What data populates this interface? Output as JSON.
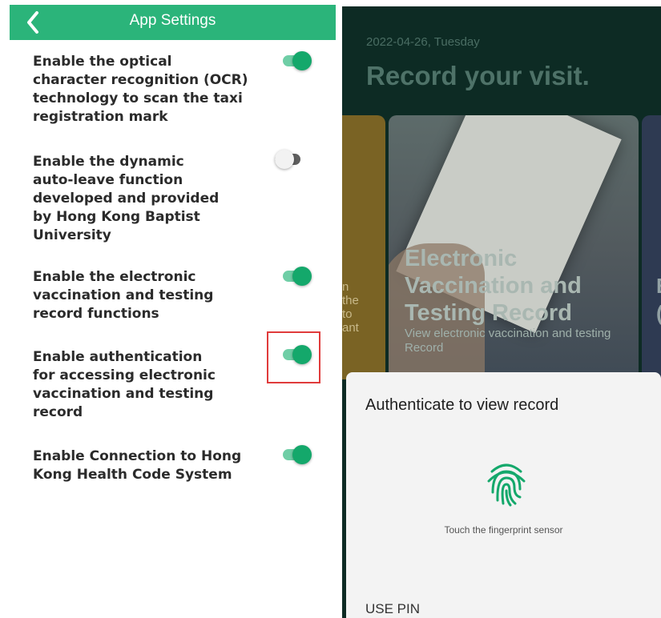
{
  "left_panel": {
    "title": "App Settings",
    "settings": [
      {
        "label": "Enable the optical character recognition (OCR) technology to scan the taxi registration mark",
        "enabled": true
      },
      {
        "label": "Enable the dynamic auto-leave function developed and provided by Hong Kong Baptist University",
        "enabled": false
      },
      {
        "label": "Enable the electronic vaccination and testing record functions",
        "enabled": true
      },
      {
        "label": "Enable authentication for accessing electronic vaccination and testing record",
        "enabled": true
      },
      {
        "label": "Enable Connection to Hong Kong Health Code System",
        "enabled": true
      }
    ],
    "colors": {
      "accent": "#2bb47a",
      "toggle_on": "#14a86b",
      "highlight": "#e03b3b"
    }
  },
  "right_panel": {
    "date": "2022-04-26, Tuesday",
    "headline": "Record your visit.",
    "left_card_partial_lines": [
      "n",
      "the",
      "to",
      "ant"
    ],
    "main_card": {
      "title": "Electronic Vaccination and Testing Record",
      "subtitle": "View electronic vaccination and testing Record"
    },
    "right_card_partial_lines": [
      "E",
      "("
    ],
    "auth_sheet": {
      "title": "Authenticate to view record",
      "hint": "Touch the fingerprint sensor",
      "use_pin": "USE PIN"
    }
  }
}
